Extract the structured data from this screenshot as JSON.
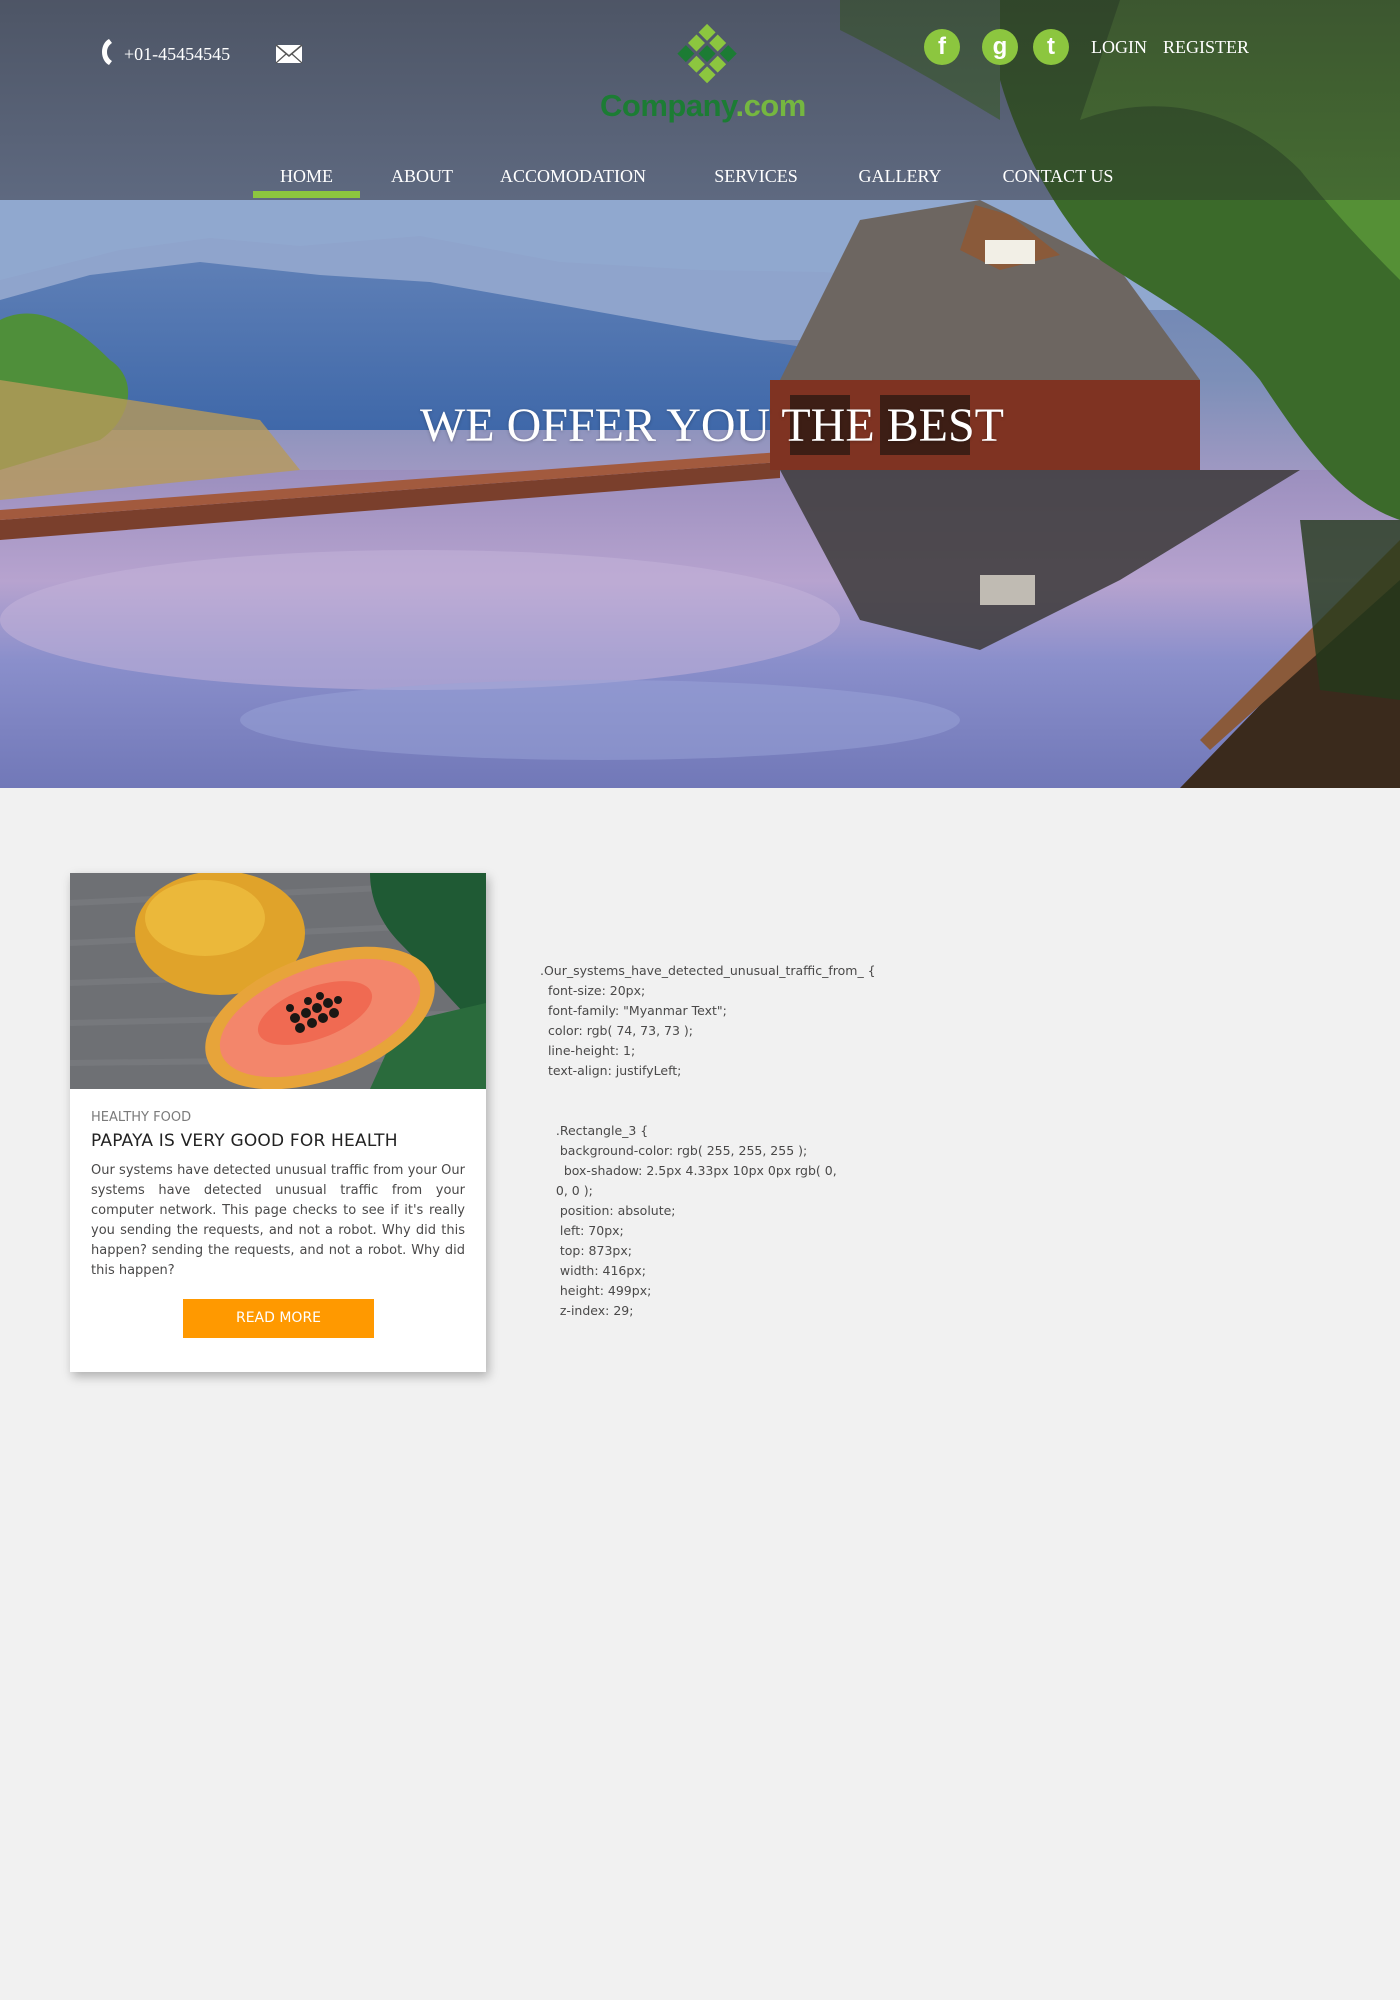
{
  "header": {
    "phone": "+01-45454545",
    "logo": {
      "name": "Company",
      "tld": ".com"
    },
    "social": [
      {
        "name": "facebook",
        "glyph": "f"
      },
      {
        "name": "google",
        "glyph": "g"
      },
      {
        "name": "tumblr",
        "glyph": "t"
      }
    ],
    "login_label": "LOGIN",
    "register_label": "REGISTER"
  },
  "nav": {
    "items": [
      {
        "label": "HOME",
        "active": true
      },
      {
        "label": "ABOUT"
      },
      {
        "label": "ACCOMODATION"
      },
      {
        "label": "SERVICES"
      },
      {
        "label": "GALLERY"
      },
      {
        "label": "CONTACT US"
      }
    ]
  },
  "hero": {
    "title": "WE OFFER YOU THE BEST"
  },
  "card": {
    "kicker": "HEALTHY FOOD",
    "title": "PAPAYA IS VERY GOOD FOR HEALTH",
    "body": "Our systems have detected unusual traffic from your Our systems have detected unusual traffic from your computer network. This page checks to see if it's really you sending the requests, and not a robot. Why did this happen? sending the requests, and not a robot. Why did this happen?",
    "button_label": "READ MORE"
  },
  "code_note": ".Our_systems_have_detected_unusual_traffic_from_ {\n  font-size: 20px;\n  font-family: \"Myanmar Text\";\n  color: rgb( 74, 73, 73 );\n  line-height: 1;\n  text-align: justifyLeft;\n\n\n    .Rectangle_3 {\n     background-color: rgb( 255, 255, 255 );\n      box-shadow: 2.5px 4.33px 10px 0px rgb( 0,\n    0, 0 );\n     position: absolute;\n     left: 70px;\n     top: 873px;\n     width: 416px;\n     height: 499px;\n     z-index: 29;",
  "colors": {
    "accent_green": "#8cc63f",
    "logo_green": "#1c7c34",
    "button_orange": "#ff9900",
    "body_text": "#4a4949",
    "page_bg": "#f1f1f1"
  }
}
